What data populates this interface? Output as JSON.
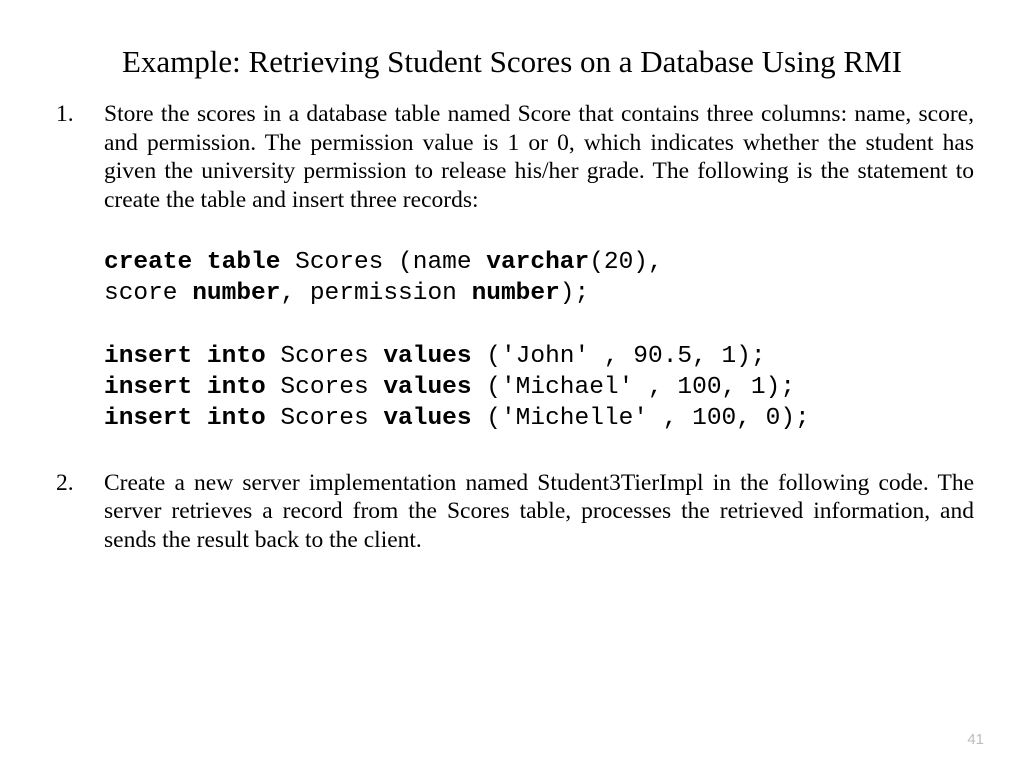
{
  "title": "Example: Retrieving Student Scores on a Database Using RMI",
  "items": {
    "one": {
      "num": "1.",
      "text": "Store the scores in a database table named Score that contains three columns: name, score, and permission. The permission value is 1 or 0, which indicates whether the student has given the university permission to release his/her grade. The following is the statement to create the table and insert three records:"
    },
    "two": {
      "num": "2.",
      "text": "Create a new server implementation named Student3TierImpl in the following code. The server retrieves a record from the Scores table, processes the retrieved information, and sends the result back to the client."
    }
  },
  "code": {
    "l1a": "create table",
    "l1b": " Scores (name ",
    "l1c": "varchar",
    "l1d": "(20),",
    "l2a": "score ",
    "l2b": "number",
    "l2c": ", permission ",
    "l2d": "number",
    "l2e": ");",
    "l3a": "insert into",
    "l3b": " Scores ",
    "l3c": "values",
    "l3d": " ('John' , 90.5, 1);",
    "l4a": "insert into",
    "l4b": " Scores ",
    "l4c": "values",
    "l4d": " ('Michael' , 100, 1);",
    "l5a": "insert into",
    "l5b": " Scores ",
    "l5c": "values",
    "l5d": " ('Michelle' , 100, 0);"
  },
  "pagenum": "41"
}
